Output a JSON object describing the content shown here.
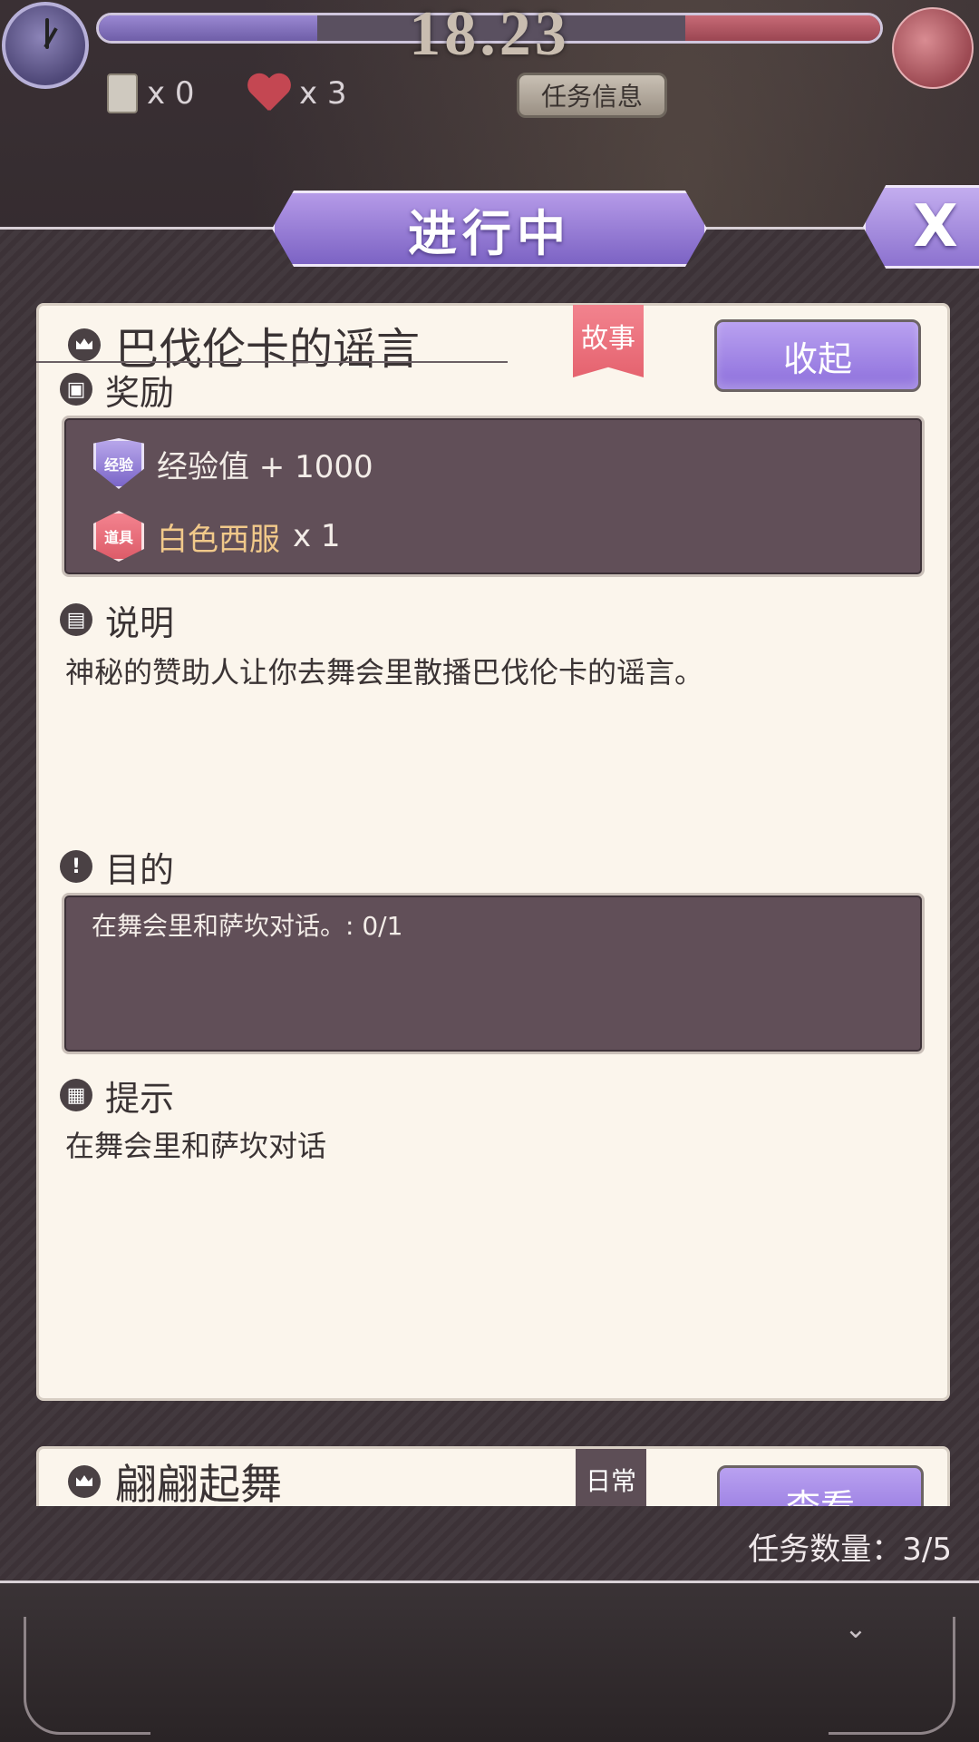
{
  "hud": {
    "time": "18.23",
    "scroll_count": "x 0",
    "heart_count": "x 3",
    "task_info_label": "任务信息",
    "left_bar_fill": 0.28,
    "right_bar_fill": 0.25
  },
  "panel": {
    "title": "进行中",
    "close_label": "X"
  },
  "quest": {
    "title": "巴伐伦卡的谣言",
    "tag": "故事",
    "collapse_label": "收起",
    "reward_heading": "奖励",
    "rewards": [
      {
        "badge": "经验",
        "text": "经验值 + 1000"
      },
      {
        "badge": "道具",
        "name": "白色西服",
        "qty": "x 1"
      }
    ],
    "description_heading": "说明",
    "description": "神秘的赞助人让你去舞会里散播巴伐伦卡的谣言。",
    "objective_heading": "目的",
    "objective": "在舞会里和萨坎对话。: 0/1",
    "hint_heading": "提示",
    "hint": "在舞会里和萨坎对话"
  },
  "quest2": {
    "title": "翩翩起舞",
    "tag": "日常",
    "view_label": "查看"
  },
  "footer": {
    "task_count": "任务数量：3/5"
  },
  "colors": {
    "accent_purple": "#8d6fdc",
    "tag_pink": "#e5636f",
    "item_gold": "#f1c98a"
  }
}
